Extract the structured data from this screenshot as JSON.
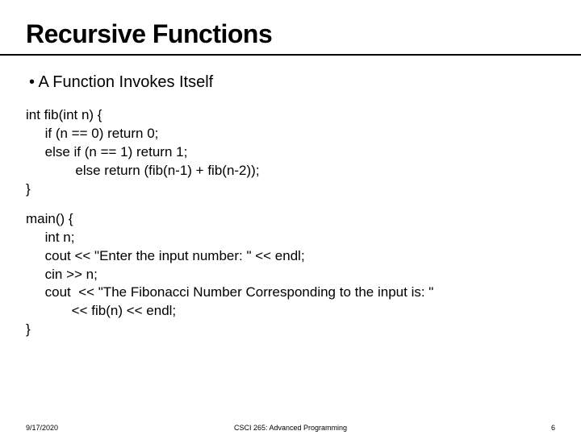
{
  "title": "Recursive Functions",
  "bullet": "• A Function Invokes Itself",
  "code1": "int fib(int n) {\n     if (n == 0) return 0;\n     else if (n == 1) return 1;\n             else return (fib(n-1) + fib(n-2));\n}",
  "code2": "main() {\n     int n;\n     cout << \"Enter the input number: \" << endl;\n     cin >> n;\n     cout  << \"The Fibonacci Number Corresponding to the input is: \"\n            << fib(n) << endl;\n}",
  "footer": {
    "date": "9/17/2020",
    "course": "CSCI 265: Advanced Programming",
    "page": "6"
  }
}
